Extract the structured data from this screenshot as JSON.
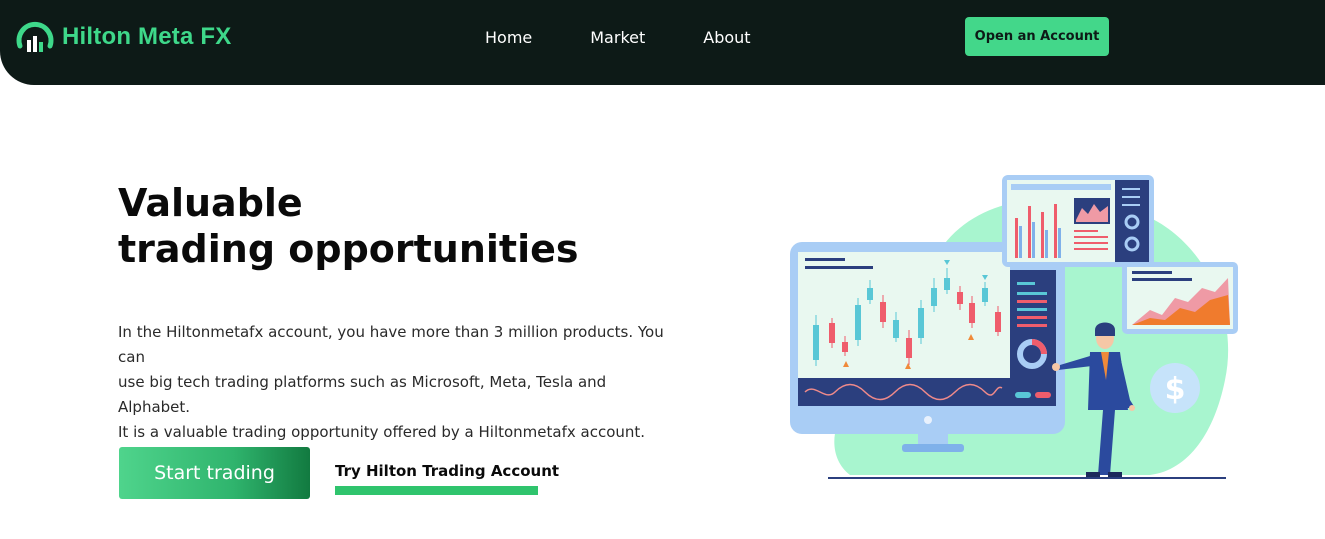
{
  "brand": {
    "name": "Hilton Meta FX",
    "accent": "#3ed88a",
    "dark": "#0d1a17"
  },
  "nav": {
    "items": [
      {
        "label": "Home"
      },
      {
        "label": "Market"
      },
      {
        "label": "About"
      }
    ],
    "cta_label": "Open an Account"
  },
  "hero": {
    "title_line1": "Valuable",
    "title_line2": "trading opportunities",
    "description_line1": "In the Hiltonmetafx account, you have more than 3 million products. You can",
    "description_line2": "use big tech trading platforms such as Microsoft, Meta, Tesla and Alphabet.",
    "description_line3": "It is a valuable trading opportunity offered by a Hiltonmetafx account.",
    "primary_button": "Start trading",
    "secondary_link": "Try Hilton Trading Account"
  },
  "illustration": {
    "icons": [
      "dollar-icon"
    ],
    "colors": {
      "blob": "#a8f5cf",
      "monitor": "#a9cdf5",
      "panel_dark": "#2b3f7e",
      "candle_red": "#ef5d6c",
      "candle_teal": "#59c7d6",
      "area_orange": "#f07b2d"
    }
  }
}
